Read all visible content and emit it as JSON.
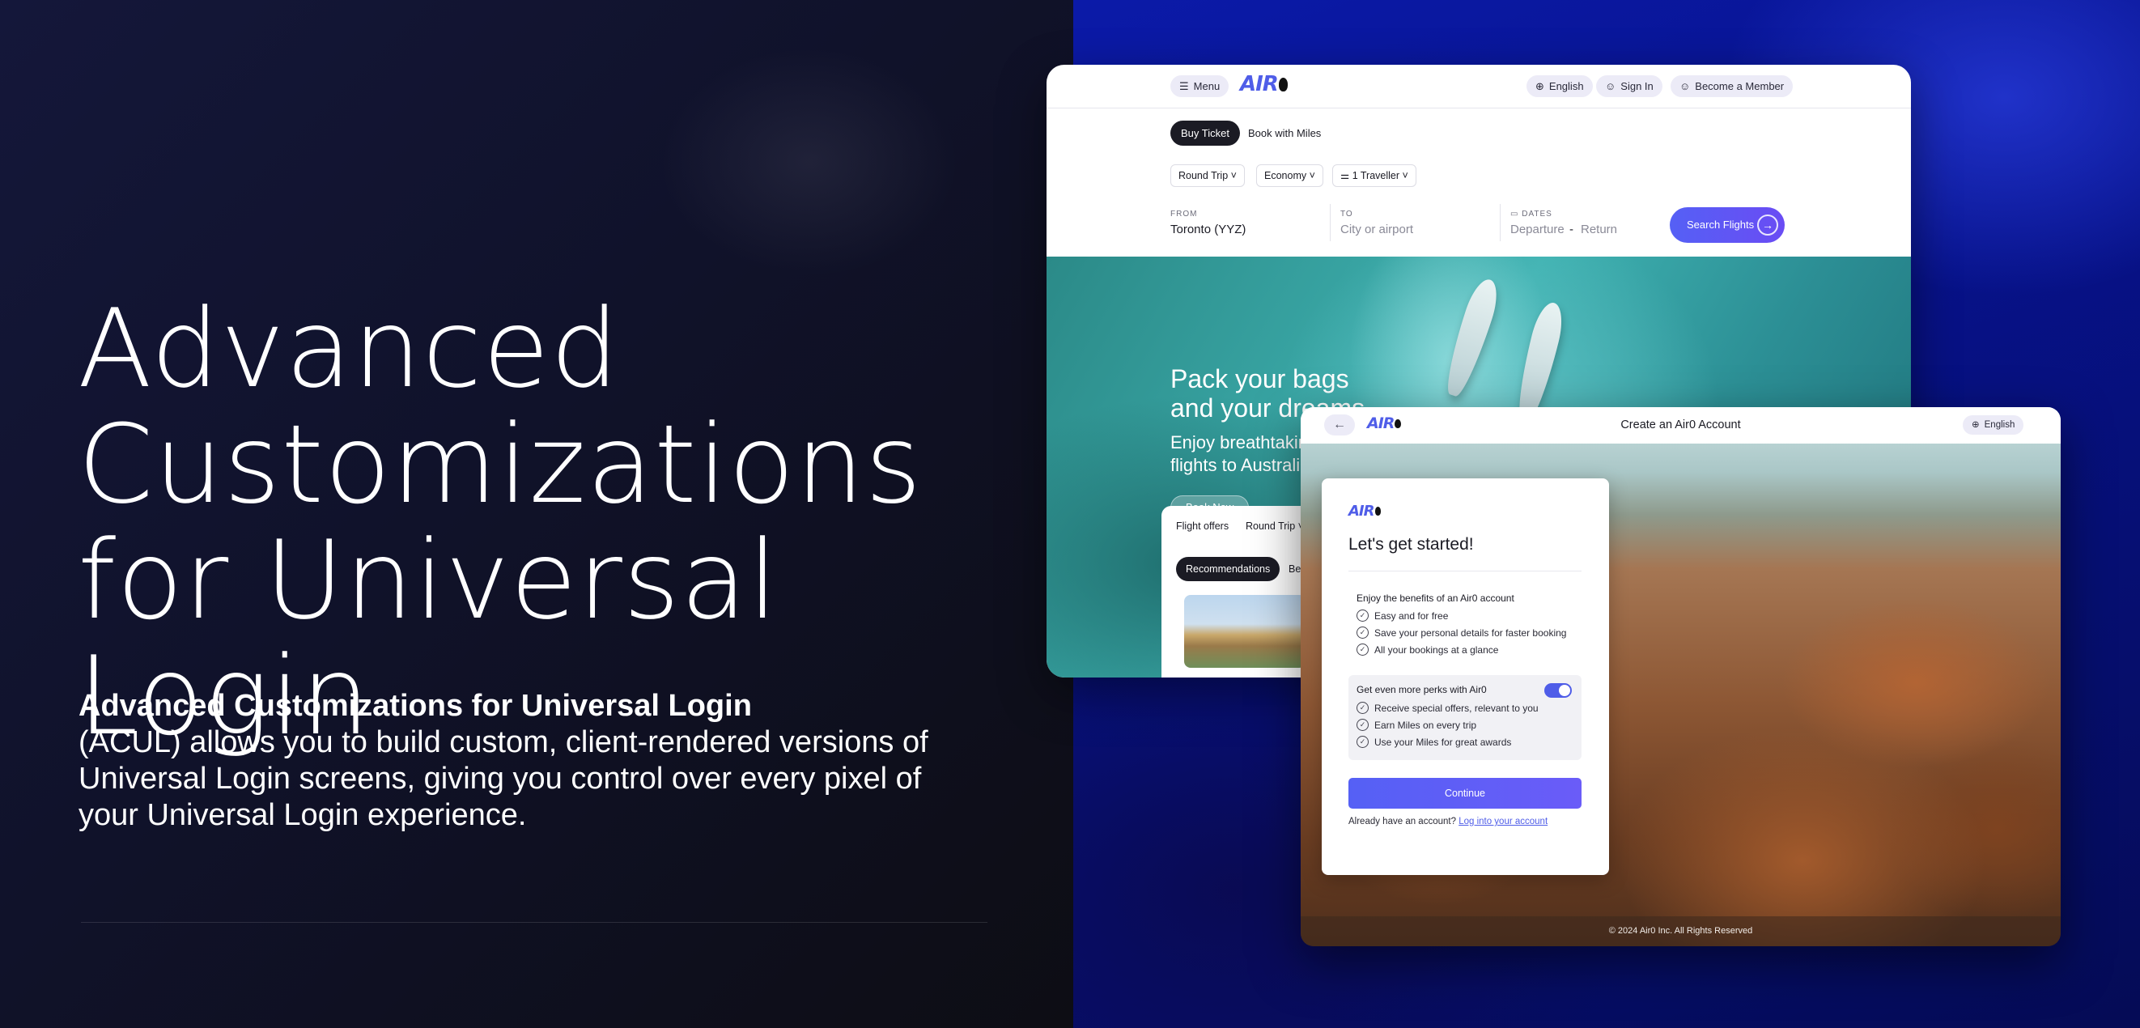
{
  "hero": {
    "title_line1": "Advanced",
    "title_line2": "Customizations",
    "title_line3": "for Universal Login",
    "desc_bold": "Advanced Customizations for Universal Login",
    "desc_rest": "(ACUL) allows you to build custom, client-rendered versions of Universal Login screens, giving you control over every pixel of your Universal Login experience."
  },
  "booking": {
    "nav": {
      "menu": "Menu",
      "logo": "AIR",
      "language": "English",
      "sign_in": "Sign In",
      "member": "Become a Member"
    },
    "tabs": [
      "Buy Ticket",
      "Book with Miles"
    ],
    "trip_type": "Round Trip",
    "cabin": "Economy",
    "travellers": "1 Traveller",
    "from_label": "FROM",
    "from_value": "Toronto (YYZ)",
    "to_label": "TO",
    "to_placeholder": "City or airport",
    "dates_label": "DATES",
    "departure_placeholder": "Departure",
    "date_sep": "-",
    "return_placeholder": "Return",
    "search_label": "Search Flights",
    "promo_line1": "Pack your bags",
    "promo_line2": "and your dreams.",
    "promo_sub": "Enjoy breathtaking views with nonstop flights to Australia",
    "promo_button": "Book Now",
    "offers_title": "Flight offers",
    "offers_trip": "Round Trip",
    "rec_label": "Recommendations",
    "rec_next": "Be"
  },
  "signup": {
    "logo": "AIR",
    "title": "Create an Air0 Account",
    "language": "English",
    "card_logo": "AIR",
    "heading": "Let's get started!",
    "benefits_head": "Enjoy the benefits of an Air0 account",
    "benefits": [
      "Easy and for free",
      "Save your personal details for faster booking",
      "All your bookings at a glance"
    ],
    "perks_head": "Get even more perks with Air0",
    "perks_toggle_on": true,
    "perks": [
      "Receive special offers, relevant to you",
      "Earn Miles on every trip",
      "Use your Miles for great awards"
    ],
    "continue": "Continue",
    "have_account": "Already have an account?",
    "login_link": "Log into your account",
    "footer": "© 2024 Air0 Inc. All Rights Reserved"
  },
  "colors": {
    "accent": "#4f5de8",
    "dark_pill": "#1b1b24",
    "right_panel": "#0b1aa8"
  }
}
